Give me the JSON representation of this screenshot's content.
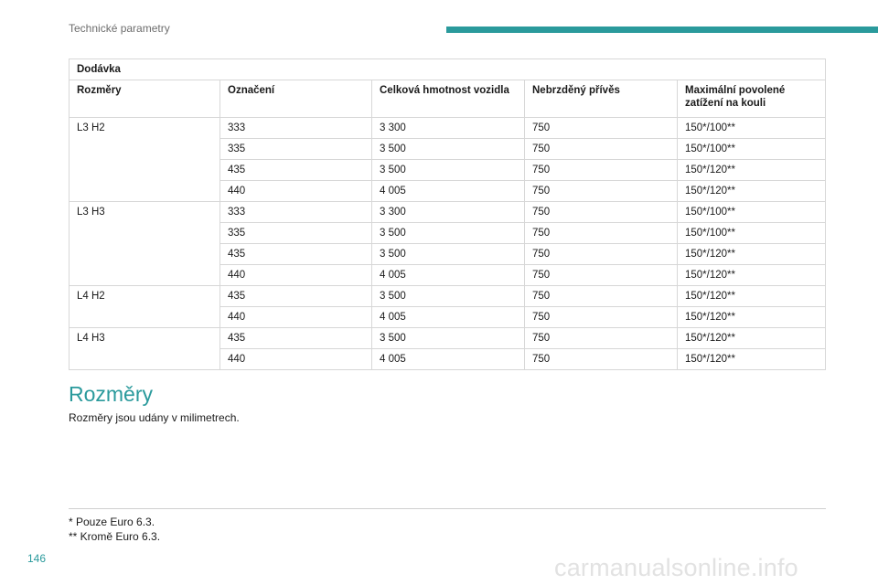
{
  "header": {
    "title": "Technické parametry",
    "accent_color": "#2a9a9c"
  },
  "table": {
    "caption": "Dodávka",
    "headers": [
      "Rozměry",
      "Označení",
      "Celková hmotnost vozidla",
      "Nebrzděný přívěs",
      "Maximální povolené zatížení na kouli"
    ],
    "groups": [
      {
        "dimension": "L3 H2",
        "rows": [
          [
            "333",
            "3 300",
            "750",
            "150*/100**"
          ],
          [
            "335",
            "3 500",
            "750",
            "150*/100**"
          ],
          [
            "435",
            "3 500",
            "750",
            "150*/120**"
          ],
          [
            "440",
            "4 005",
            "750",
            "150*/120**"
          ]
        ]
      },
      {
        "dimension": "L3 H3",
        "rows": [
          [
            "333",
            "3 300",
            "750",
            "150*/100**"
          ],
          [
            "335",
            "3 500",
            "750",
            "150*/100**"
          ],
          [
            "435",
            "3 500",
            "750",
            "150*/120**"
          ],
          [
            "440",
            "4 005",
            "750",
            "150*/120**"
          ]
        ]
      },
      {
        "dimension": "L4 H2",
        "rows": [
          [
            "435",
            "3 500",
            "750",
            "150*/120**"
          ],
          [
            "440",
            "4 005",
            "750",
            "150*/120**"
          ]
        ]
      },
      {
        "dimension": "L4 H3",
        "rows": [
          [
            "435",
            "3 500",
            "750",
            "150*/120**"
          ],
          [
            "440",
            "4 005",
            "750",
            "150*/120**"
          ]
        ]
      }
    ]
  },
  "section": {
    "title": "Rozměry",
    "text": "Rozměry jsou udány v milimetrech."
  },
  "footnotes": [
    "* Pouze Euro 6.3.",
    "** Kromě Euro 6.3."
  ],
  "page_number": "146",
  "watermark": "carmanualsonline.info"
}
